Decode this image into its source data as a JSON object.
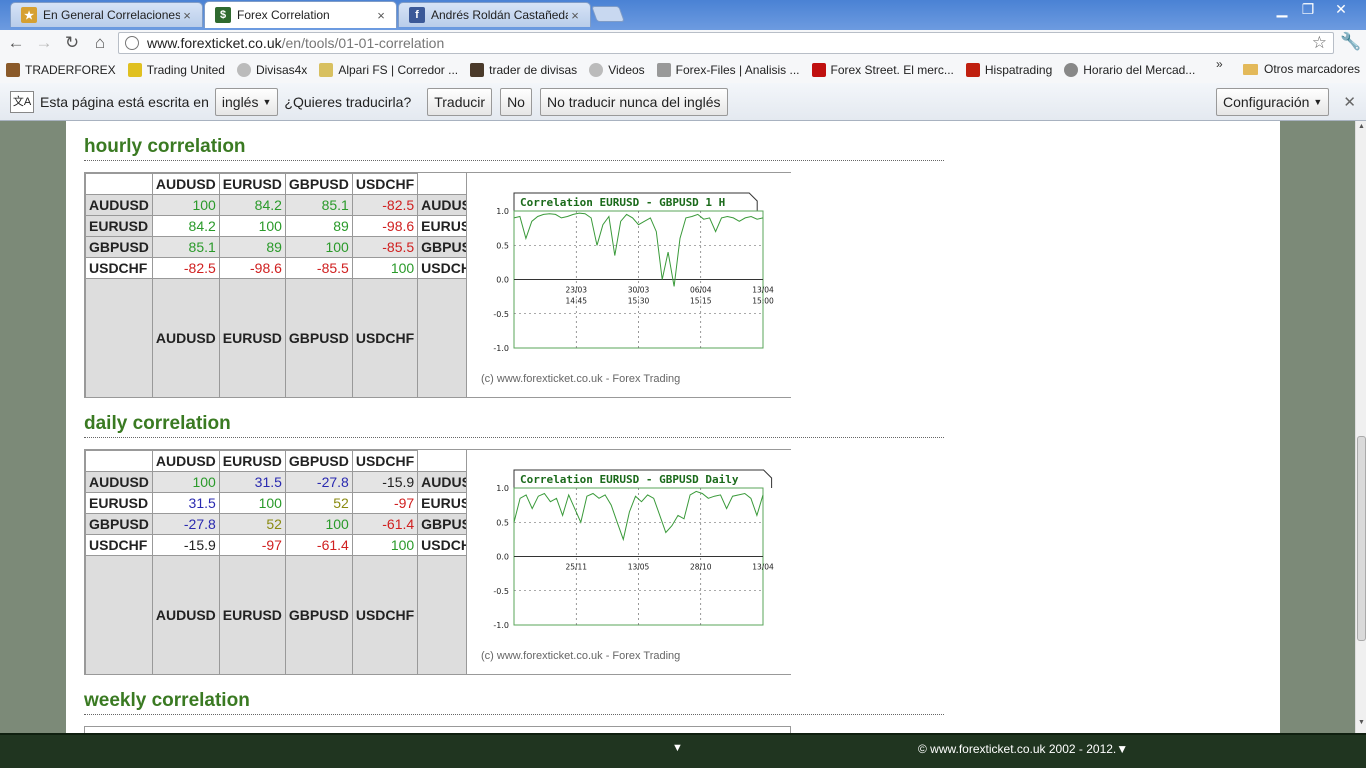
{
  "browser": {
    "tabs": [
      {
        "label": "En General Correlaciones",
        "active": false,
        "icon": "forum-favicon"
      },
      {
        "label": "Forex Correlation",
        "active": true,
        "icon": "forexticket-favicon"
      },
      {
        "label": "Andrés Roldán Castañeda",
        "active": false,
        "icon": "facebook-favicon"
      }
    ],
    "url_host": "www.forexticket.co.uk",
    "url_path": "/en/tools/01-01-correlation",
    "bookmarks": [
      "TRADERFOREX",
      "Trading United",
      "Divisas4x",
      "Alpari FS | Corredor ...",
      "trader de divisas",
      "Videos",
      "Forex-Files | Analisis ...",
      "Forex Street. El merc...",
      "Hispatrading",
      "Horario del Mercad..."
    ],
    "bookmarks_more": "»",
    "other_bookmarks": "Otros marcadores"
  },
  "translate_bar": {
    "message": "Esta página está escrita en",
    "language": "inglés",
    "question": "¿Quieres traducirla?",
    "translate_btn": "Traducir",
    "no_btn": "No",
    "never_btn": "No traducir nunca del inglés",
    "settings_btn": "Configuración"
  },
  "sections": [
    {
      "title": "hourly correlation",
      "columns": [
        "AUDUSD",
        "EURUSD",
        "GBPUSD",
        "USDCHF"
      ],
      "rows": [
        {
          "label": "AUDUSD",
          "values": [
            "100",
            "84.2",
            "85.1",
            "-82.5"
          ],
          "colors": [
            "pos",
            "pos",
            "pos",
            "neg"
          ]
        },
        {
          "label": "EURUSD",
          "values": [
            "84.2",
            "100",
            "89",
            "-98.6"
          ],
          "colors": [
            "pos",
            "pos",
            "pos",
            "neg"
          ]
        },
        {
          "label": "GBPUSD",
          "values": [
            "85.1",
            "89",
            "100",
            "-85.5"
          ],
          "colors": [
            "pos",
            "pos",
            "pos",
            "neg"
          ]
        },
        {
          "label": "USDCHF",
          "values": [
            "-82.5",
            "-98.6",
            "-85.5",
            "100"
          ],
          "colors": [
            "neg",
            "neg",
            "neg",
            "pos"
          ]
        }
      ],
      "chart": {
        "title": "Correlation EURUSD - GBPUSD 1 H",
        "yticks": [
          "1.0",
          "0.5",
          "0.0",
          "-0.5",
          "-1.0"
        ],
        "xticks": [
          [
            "23/03",
            "14:45"
          ],
          [
            "30/03",
            "15:30"
          ],
          [
            "06/04",
            "15:15"
          ],
          [
            "13/04",
            "15:00"
          ]
        ],
        "copyright": "(c) www.forexticket.co.uk - Forex Trading"
      }
    },
    {
      "title": "daily correlation",
      "columns": [
        "AUDUSD",
        "EURUSD",
        "GBPUSD",
        "USDCHF"
      ],
      "rows": [
        {
          "label": "AUDUSD",
          "values": [
            "100",
            "31.5",
            "-27.8",
            "-15.9"
          ],
          "colors": [
            "pos",
            "blu",
            "blu",
            "neu"
          ]
        },
        {
          "label": "EURUSD",
          "values": [
            "31.5",
            "100",
            "52",
            "-97"
          ],
          "colors": [
            "blu",
            "pos",
            "yel",
            "neg"
          ]
        },
        {
          "label": "GBPUSD",
          "values": [
            "-27.8",
            "52",
            "100",
            "-61.4"
          ],
          "colors": [
            "blu",
            "yel",
            "pos",
            "neg"
          ]
        },
        {
          "label": "USDCHF",
          "values": [
            "-15.9",
            "-97",
            "-61.4",
            "100"
          ],
          "colors": [
            "neu",
            "neg",
            "neg",
            "pos"
          ]
        }
      ],
      "chart": {
        "title": "Correlation EURUSD - GBPUSD Daily",
        "yticks": [
          "1.0",
          "0.5",
          "0.0",
          "-0.5",
          "-1.0"
        ],
        "xticks": [
          [
            "25/11",
            ""
          ],
          [
            "13/05",
            ""
          ],
          [
            "28/10",
            ""
          ],
          [
            "13/04",
            ""
          ]
        ],
        "copyright": "(c) www.forexticket.co.uk - Forex Trading"
      }
    },
    {
      "title": "weekly correlation"
    }
  ],
  "chart_data": [
    {
      "type": "line",
      "title": "Correlation EURUSD - GBPUSD 1 H",
      "x": [
        "23/03 14:45",
        "30/03 15:30",
        "06/04 15:15",
        "13/04 15:00"
      ],
      "ylim": [
        -1.0,
        1.0
      ],
      "series": [
        {
          "values": [
            0.9,
            0.92,
            0.6,
            0.85,
            0.92,
            0.95,
            0.96,
            0.95,
            0.9,
            0.92,
            0.95,
            0.97,
            0.96,
            0.9,
            0.5,
            0.8,
            0.92,
            0.35,
            0.85,
            0.95,
            0.9,
            0.8,
            0.85,
            0.9,
            0.7,
            0.0,
            0.4,
            -0.1,
            0.6,
            0.9,
            0.92,
            0.95,
            0.88,
            0.9,
            0.7,
            0.9,
            0.92,
            0.9,
            0.85,
            0.9,
            0.92,
            0.88,
            0.9
          ]
        }
      ]
    },
    {
      "type": "line",
      "title": "Correlation EURUSD - GBPUSD Daily",
      "x": [
        "25/11",
        "13/05",
        "28/10",
        "13/04"
      ],
      "ylim": [
        -1.0,
        1.0
      ],
      "series": [
        {
          "values": [
            0.5,
            0.85,
            0.9,
            0.7,
            0.88,
            0.92,
            0.8,
            0.85,
            0.6,
            0.9,
            0.7,
            0.5,
            0.88,
            0.92,
            0.85,
            0.9,
            0.75,
            0.5,
            0.25,
            0.65,
            0.88,
            0.8,
            0.9,
            0.85,
            0.6,
            0.35,
            0.45,
            0.6,
            0.55,
            0.9,
            0.95,
            0.92,
            0.85,
            0.88,
            0.9,
            0.7,
            0.88,
            0.9,
            0.92,
            0.85,
            0.6,
            0.9
          ]
        }
      ]
    }
  ],
  "status_bar": {
    "arrow": "▼",
    "copyright": "© www.forexticket.co.uk 2002 - 2012.▼"
  }
}
